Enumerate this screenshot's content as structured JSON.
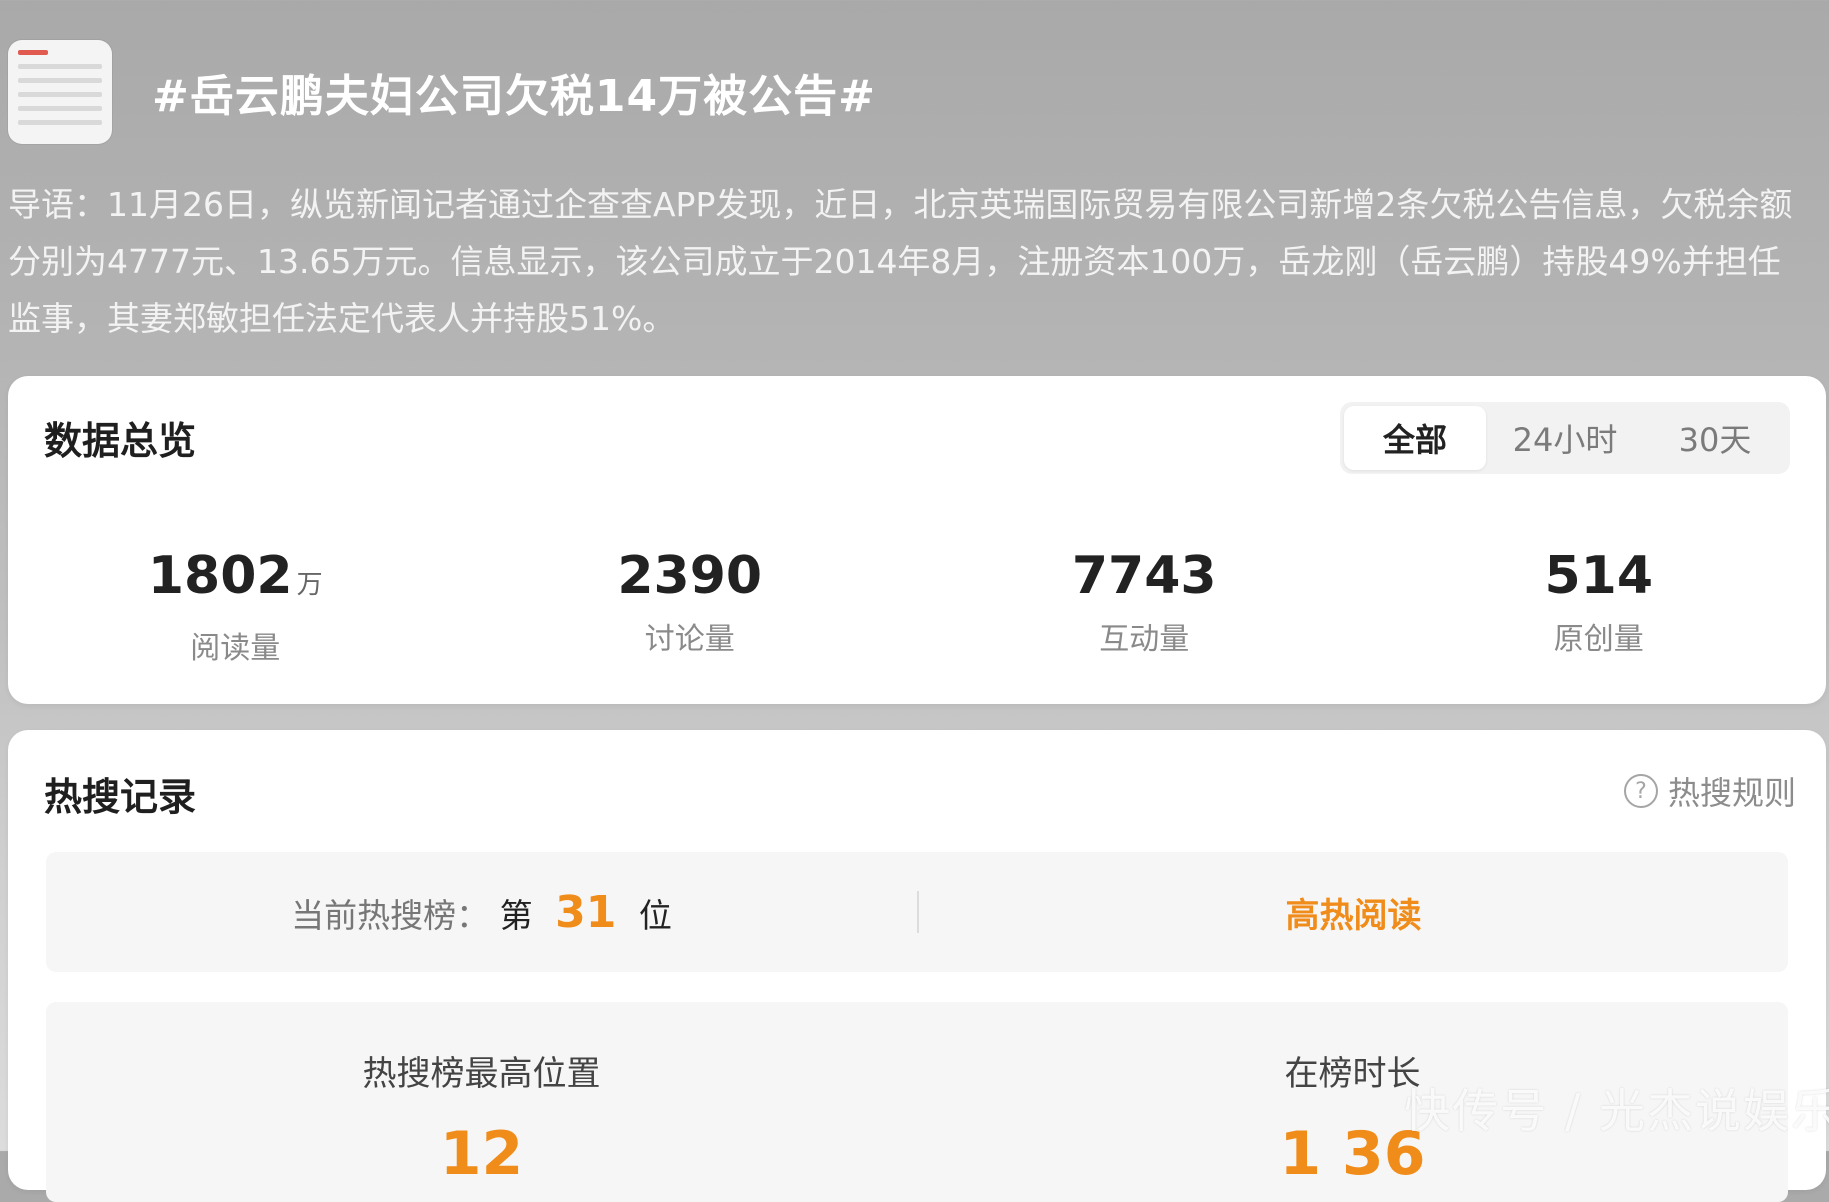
{
  "topic": {
    "title": "#岳云鹏夫妇公司欠税14万被公告#"
  },
  "lead": {
    "text": "导语：11月26日，纵览新闻记者通过企查查APP发现，近日，北京英瑞国际贸易有限公司新增2条欠税公告信息，欠税余额分别为4777元、13.65万元。信息显示，该公司成立于2014年8月，注册资本100万，岳龙刚（岳云鹏）持股49%并担任监事，其妻郑敏担任法定代表人并持股51%。"
  },
  "overview": {
    "title": "数据总览",
    "tabs": [
      "全部",
      "24小时",
      "30天"
    ],
    "active_tab": "全部",
    "stats": [
      {
        "value": "1802",
        "unit": "万",
        "label": "阅读量"
      },
      {
        "value": "2390",
        "unit": "",
        "label": "讨论量"
      },
      {
        "value": "7743",
        "unit": "",
        "label": "互动量"
      },
      {
        "value": "514",
        "unit": "",
        "label": "原创量"
      }
    ]
  },
  "hot": {
    "title": "热搜记录",
    "rule_label": "热搜规则",
    "rank_prefix_label": "当前热搜榜：",
    "rank_pre": "第",
    "rank_value": "31",
    "rank_post": "位",
    "status": "高热阅读",
    "metrics": [
      {
        "label": "热搜榜最高位置",
        "value": "12"
      },
      {
        "label": "在榜时长",
        "value": "1 36"
      }
    ]
  },
  "watermark": "快传号 / 光杰说娱乐"
}
